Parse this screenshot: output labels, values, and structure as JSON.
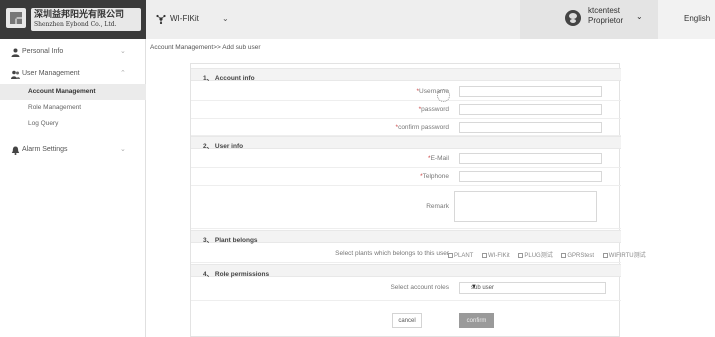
{
  "header": {
    "company_cn": "深圳益邦阳光有限公司",
    "company_en": "Shenzhen Eybond Co., Ltd.",
    "app_label": "WI-FIKit",
    "user_name": "ktcentest",
    "user_role": "Proprietor",
    "language": "English"
  },
  "sidebar": {
    "groups": [
      {
        "label": "Personal Info",
        "icon": "user-icon"
      },
      {
        "label": "User Management",
        "icon": "users-icon"
      },
      {
        "label": "Alarm Settings",
        "icon": "bell-icon"
      }
    ],
    "submenu": [
      {
        "label": "Account Management",
        "active": true
      },
      {
        "label": "Role Management"
      },
      {
        "label": "Log Query"
      }
    ]
  },
  "breadcrumb": "Account Management>> Add sub user",
  "form": {
    "sections": {
      "account_info": "1、 Account info",
      "user_info": "2、 User info",
      "plant_belongs": "3、 Plant belongs",
      "role_permissions": "4、 Role permissions"
    },
    "fields": {
      "username": "Username",
      "password": "password",
      "confirm_password": "confirm password",
      "email": "E-Mail",
      "telephone": "Telphone",
      "remark": "Remark"
    },
    "required_mark": "*",
    "plants_label": "Select plants which belongs to this user",
    "plants": [
      "PLANT",
      "WI-FIKit",
      "PLUG测试",
      "GPRStest",
      "WIFIRTU测试"
    ],
    "roles_label": "Select account roles",
    "role_value": "sub user",
    "cancel_label": "cancel",
    "confirm_label": "confirm"
  },
  "colors": {
    "topbar_bg": "#3a3a3a",
    "confirm_bg": "#9a9a9a",
    "active_menu_bg": "#ebebeb"
  }
}
